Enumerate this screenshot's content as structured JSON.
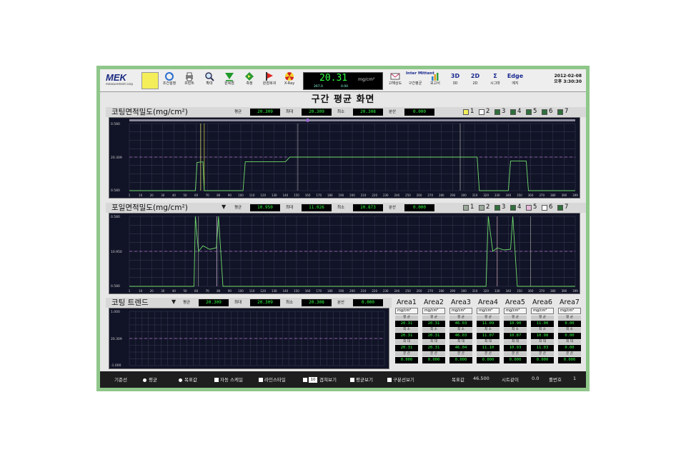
{
  "toolbar": {
    "logo": "MEK",
    "logo_sub": "measurement corp",
    "buttons": [
      {
        "label": "조건설정",
        "icon": "recycle-icon"
      },
      {
        "label": "프린트",
        "icon": "printer-icon"
      },
      {
        "label": "확대",
        "icon": "magnifier-icon"
      },
      {
        "label": "원복점",
        "icon": "down-triangle-icon"
      },
      {
        "label": "측정",
        "icon": "diamond-arrow-icon"
      },
      {
        "label": "원점복귀",
        "icon": "home-flag-icon"
      },
      {
        "label": "X-Ray",
        "icon": "radiation-icon"
      }
    ],
    "readout": {
      "value": "20.31",
      "unit": "mg/cm²",
      "sub1": "267.0",
      "sub2": "0.00"
    },
    "right_buttons": [
      {
        "title": "",
        "label": "고해상도",
        "icon": "envelope-icon"
      },
      {
        "title": "Inter Mittent",
        "label": "구간평균",
        "icon": "intermittent-icon"
      },
      {
        "title": "",
        "label": "보고서",
        "icon": "bar-chart-icon"
      },
      {
        "title": "3D",
        "label": "3D",
        "icon": "3d-icon"
      },
      {
        "title": "2D",
        "label": "2D",
        "icon": "2d-icon"
      },
      {
        "title": "Σ",
        "label": "시그마",
        "icon": "sigma-icon"
      },
      {
        "title": "Edge",
        "label": "에지",
        "icon": "edge-icon"
      }
    ],
    "date": "2012-02-08",
    "time": "오후 3:30:30"
  },
  "page_title": "구간 평균 화면",
  "section1": {
    "name": "코팅면적밀도(mg/cm²)",
    "stats": [
      {
        "label": "평균",
        "value": "20.309"
      },
      {
        "label": "최대",
        "value": "20.309"
      },
      {
        "label": "최소",
        "value": "20.308"
      },
      {
        "label": "분산",
        "value": "0.000"
      }
    ],
    "swatches": [
      {
        "label": "1",
        "color": "#f2ee5a"
      },
      {
        "label": "2",
        "color": "#ffffff"
      },
      {
        "label": "3",
        "color": "#2f6f3a"
      },
      {
        "label": "4",
        "color": "#2f6f3a"
      },
      {
        "label": "5",
        "color": "#2f6f3a"
      },
      {
        "label": "6",
        "color": "#2f6f3a"
      },
      {
        "label": "7",
        "color": "#2f6f3a"
      }
    ],
    "y_ticks": [
      "0.580",
      "20.309",
      "0.580"
    ],
    "x_ticks": [
      "1",
      "10",
      "20",
      "30",
      "40",
      "50",
      "60",
      "70",
      "80",
      "90",
      "100",
      "110",
      "120",
      "130",
      "140",
      "150",
      "160",
      "170",
      "180",
      "190",
      "200",
      "210",
      "220",
      "230",
      "240",
      "250",
      "260",
      "270",
      "280",
      "290",
      "300",
      "310",
      "320",
      "330",
      "340",
      "350",
      "360",
      "370",
      "380",
      "390",
      "399"
    ]
  },
  "section2": {
    "name": "포일면적밀도(mg/cm²)",
    "stats": [
      {
        "label": "평균",
        "value": "10.950"
      },
      {
        "label": "최대",
        "value": "11.026"
      },
      {
        "label": "최소",
        "value": "10.873"
      },
      {
        "label": "분산",
        "value": "0.000"
      }
    ],
    "swatches": [
      {
        "label": "1",
        "color": "#9aa89a"
      },
      {
        "label": "2",
        "color": "#9aa89a"
      },
      {
        "label": "3",
        "color": "#2f6f3a"
      },
      {
        "label": "4",
        "color": "#2f6f3a"
      },
      {
        "label": "5",
        "color": "#e6b8d8"
      },
      {
        "label": "6",
        "color": "#ffffff"
      },
      {
        "label": "7",
        "color": "#2f6f3a"
      }
    ],
    "y_ticks": [
      "0.580",
      "10.950",
      "0.580"
    ],
    "x_ticks": [
      "1",
      "10",
      "20",
      "30",
      "40",
      "50",
      "60",
      "70",
      "80",
      "90",
      "100",
      "110",
      "120",
      "130",
      "140",
      "150",
      "160",
      "170",
      "180",
      "190",
      "200",
      "210",
      "220",
      "230",
      "240",
      "250",
      "260",
      "270",
      "280",
      "290",
      "300",
      "310",
      "320",
      "330",
      "340",
      "350",
      "360",
      "370",
      "380",
      "390",
      "399"
    ]
  },
  "section3": {
    "name": "코팅 트렌드",
    "stats": [
      {
        "label": "평균",
        "value": "20.309"
      },
      {
        "label": "최대",
        "value": "20.309"
      },
      {
        "label": "최소",
        "value": "20.308"
      },
      {
        "label": "분산",
        "value": "0.000"
      }
    ],
    "y_ticks": [
      "1.000",
      "20.309",
      "-1.000"
    ]
  },
  "areas": [
    {
      "name": "Area1",
      "unit": "mg/cm²",
      "avg": "20.31",
      "min": "20.31",
      "max": "20.31",
      "var": "0.000"
    },
    {
      "name": "Area2",
      "unit": "mg/cm²",
      "avg": "20.31",
      "min": "20.31",
      "max": "20.31",
      "var": "0.000"
    },
    {
      "name": "Area3",
      "unit": "mg/cm²",
      "avg": "46.03",
      "min": "46.03",
      "max": "46.04",
      "var": "0.000"
    },
    {
      "name": "Area4",
      "unit": "mg/cm²",
      "avg": "11.09",
      "min": "11.07",
      "max": "11.10",
      "var": "0.000"
    },
    {
      "name": "Area5",
      "unit": "mg/cm²",
      "avg": "10.90",
      "min": "10.87",
      "max": "10.93",
      "var": "0.000"
    },
    {
      "name": "Area6",
      "unit": "mg/cm²",
      "avg": "11.00",
      "min": "10.98",
      "max": "11.03",
      "var": "0.000"
    },
    {
      "name": "Area7",
      "unit": "mg/cm²",
      "avg": "0.00",
      "min": "0.00",
      "max": "0.00",
      "var": "0.000"
    }
  ],
  "area_labels": {
    "avg": "평 균",
    "min": "최 소",
    "max": "최 대",
    "var": "분 산"
  },
  "status": {
    "basis_label": "기준선",
    "radio1": "평균",
    "radio2": "목표값",
    "chk1": "자동 스케일",
    "chk2": "라인스타일",
    "count_value": "10",
    "chk3": "겹쳐보기",
    "chk4": "평균보기",
    "chk5": "구분선보기",
    "target_label": "목표값",
    "target_value": "46.500",
    "sheet_label": "시트같이",
    "sheet_value": "0.0",
    "roll_label": "롤번호",
    "roll_value": "1"
  },
  "colors": {
    "plot_bg": "#111327",
    "trace": "#6fdc6a",
    "mean_line": "#b070c8",
    "readout_green": "#33ff44"
  }
}
